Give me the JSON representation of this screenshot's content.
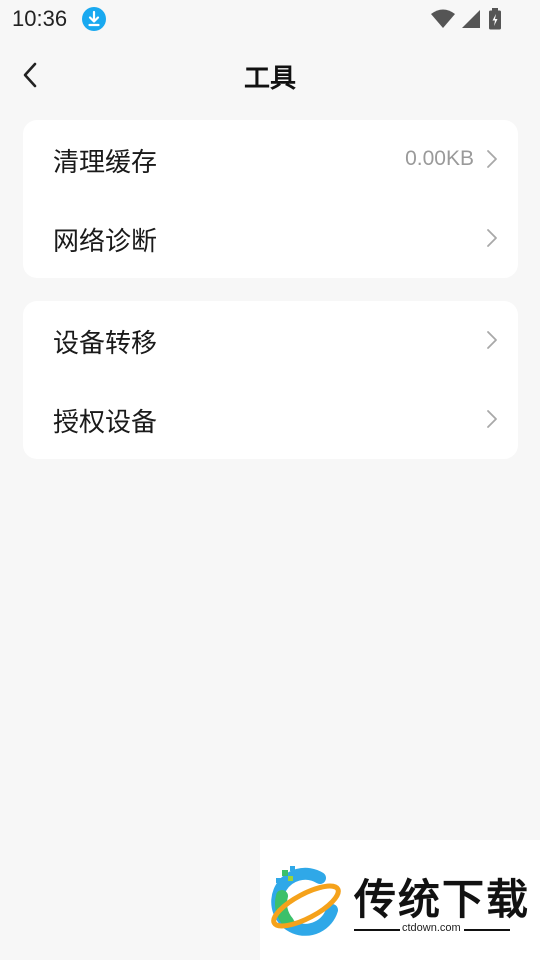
{
  "status_bar": {
    "time": "10:36"
  },
  "header": {
    "title": "工具"
  },
  "groups": [
    {
      "items": [
        {
          "label": "清理缓存",
          "value": "0.00KB"
        },
        {
          "label": "网络诊断",
          "value": ""
        }
      ]
    },
    {
      "items": [
        {
          "label": "设备转移",
          "value": ""
        },
        {
          "label": "授权设备",
          "value": ""
        }
      ]
    }
  ],
  "watermark": {
    "brand": "传统下载",
    "url": "ctdown.com"
  },
  "colors": {
    "background": "#f7f7f7",
    "card": "#ffffff",
    "secondary_text": "#9a9a9a",
    "download_badge": "#19a9f0"
  }
}
